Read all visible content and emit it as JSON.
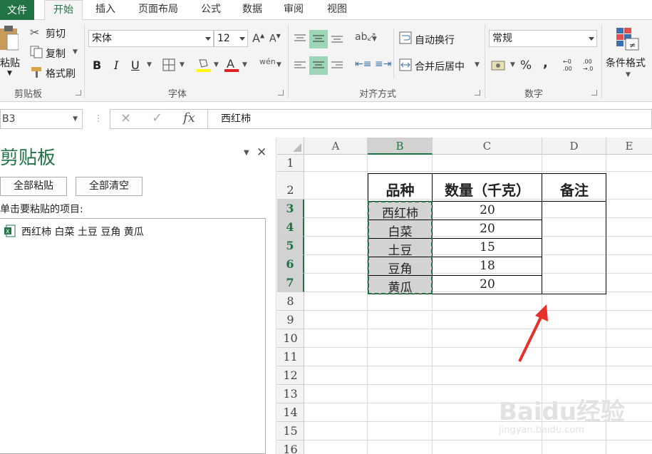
{
  "tabs": {
    "file": "文件",
    "home": "开始",
    "insert": "插入",
    "layout": "页面布局",
    "formulas": "公式",
    "data": "数据",
    "review": "审阅",
    "view": "视图"
  },
  "ribbon": {
    "clipboard": {
      "paste": "粘贴",
      "cut": "剪切",
      "copy": "复制",
      "format_painter": "格式刷",
      "group": "剪贴板"
    },
    "font": {
      "name": "宋体",
      "size": "12",
      "bold": "B",
      "italic": "I",
      "underline": "U",
      "group": "字体"
    },
    "alignment": {
      "wrap": "自动换行",
      "merge": "合并后居中",
      "group": "对齐方式"
    },
    "number": {
      "format": "常规",
      "percent": "%",
      "comma": ",",
      "inc_decimal": ".00",
      "dec_decimal": ".00",
      "group": "数字"
    },
    "styles": {
      "conditional": "条件格式"
    }
  },
  "formula_bar": {
    "name_box": "B3",
    "fx": "fx",
    "content": "西红柿"
  },
  "clipboard_pane": {
    "title": "剪贴板",
    "paste_all": "全部粘贴",
    "clear_all": "全部清空",
    "hint": "单击要粘贴的项目:",
    "items": [
      "西红柿 白菜 土豆 豆角 黄瓜"
    ]
  },
  "sheet": {
    "columns": [
      "A",
      "B",
      "C",
      "D",
      "E"
    ],
    "rows": [
      "1",
      "2",
      "3",
      "4",
      "5",
      "6",
      "7",
      "8",
      "9",
      "10",
      "11",
      "12",
      "13",
      "14",
      "15",
      "16"
    ],
    "selected_column": "B",
    "selected_rows": [
      "3",
      "4",
      "5",
      "6",
      "7"
    ],
    "headers": [
      "品种",
      "数量（千克）",
      "备注"
    ],
    "data": [
      {
        "variety": "西红柿",
        "qty": "20"
      },
      {
        "variety": "白菜",
        "qty": "20"
      },
      {
        "variety": "土豆",
        "qty": "15"
      },
      {
        "variety": "豆角",
        "qty": "18"
      },
      {
        "variety": "黄瓜",
        "qty": "20"
      }
    ]
  },
  "watermark": {
    "text": "Baidu经验",
    "url": "jingyan.baidu.com"
  },
  "colors": {
    "accent": "#217346",
    "selection": "#d3d3d3",
    "arrow": "#e8302a"
  }
}
